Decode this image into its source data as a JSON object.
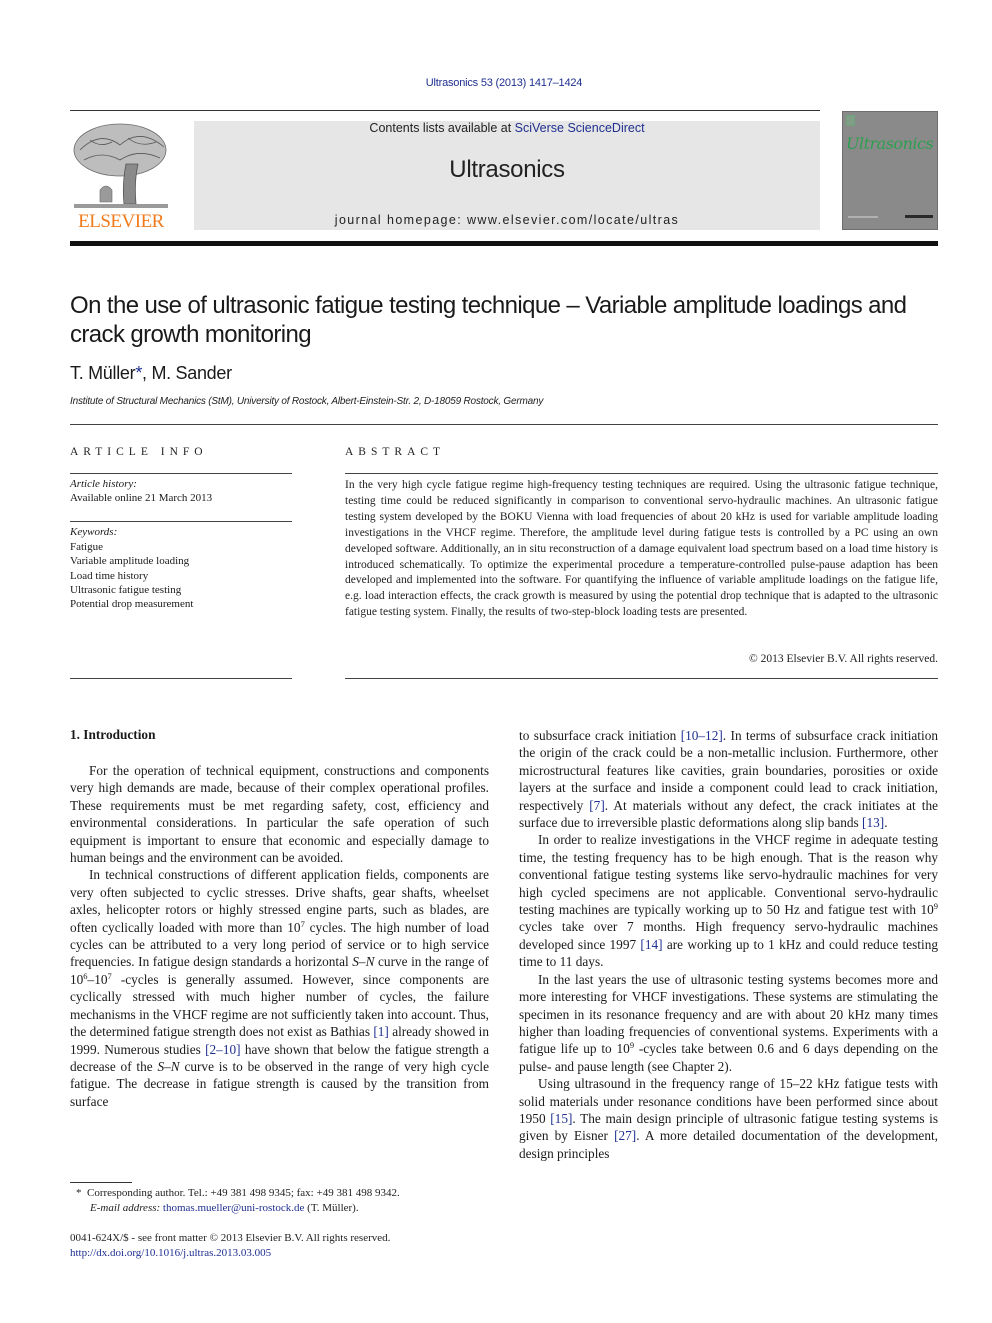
{
  "header": {
    "citation": "Ultrasonics 53 (2013) 1417–1424",
    "contents_prefix": "Contents lists available at ",
    "contents_link": "SciVerse ScienceDirect",
    "journal_name": "Ultrasonics",
    "homepage": "journal homepage: www.elsevier.com/locate/ultras",
    "publisher_logo_text": "ELSEVIER",
    "cover_title": "Ultrasonics",
    "colors": {
      "link": "#1f2f8f",
      "elsevier_orange": "#f07b1d",
      "cover_green": "#2e9e4f",
      "banner_bg": "#e6e6e6"
    }
  },
  "article": {
    "title": "On the use of ultrasonic fatigue testing technique – Variable amplitude loadings and crack growth monitoring",
    "authors": [
      {
        "name": "T. Müller",
        "marker": "*"
      },
      {
        "name": "M. Sander",
        "marker": ""
      }
    ],
    "author_separator": ", ",
    "affiliation": "Institute of Structural Mechanics (StM), University of Rostock, Albert-Einstein-Str. 2, D-18059 Rostock, Germany"
  },
  "article_info": {
    "heading": "ARTICLE INFO",
    "history_label": "Article history:",
    "history_value": "Available online 21 March 2013",
    "keywords_label": "Keywords:",
    "keywords": [
      "Fatigue",
      "Variable amplitude loading",
      "Load time history",
      "Ultrasonic fatigue testing",
      "Potential drop measurement"
    ]
  },
  "abstract": {
    "heading": "ABSTRACT",
    "text": "In the very high cycle fatigue regime high-frequency testing techniques are required. Using the ultrasonic fatigue technique, testing time could be reduced significantly in comparison to conventional servo-hydraulic machines. An ultrasonic fatigue testing system developed by the BOKU Vienna with load frequencies of about 20 kHz is used for variable amplitude loading investigations in the VHCF regime. Therefore, the amplitude level during fatigue tests is controlled by a PC using an own developed software. Additionally, an in situ reconstruction of a damage equivalent load spectrum based on a load time history is introduced schematically. To optimize the experimental procedure a temperature-controlled pulse-pause adaption has been developed and implemented into the software. For quantifying the influence of variable amplitude loadings on the fatigue life, e.g. load interaction effects, the crack growth is measured by using the potential drop technique that is adapted to the ultrasonic fatigue testing system. Finally, the results of two-step-block loading tests are presented.",
    "copyright": "© 2013 Elsevier B.V. All rights reserved."
  },
  "body": {
    "section_heading": "1. Introduction",
    "p1": "For the operation of technical equipment, constructions and components very high demands are made, because of their complex operational profiles. These requirements must be met regarding safety, cost, efficiency and environmental considerations. In particular the safe operation of such equipment is important to ensure that economic and especially damage to human beings and the environment can be avoided.",
    "p2": {
      "a": "In technical constructions of different application fields, components are very often subjected to cyclic stresses. Drive shafts, gear shafts, wheelset axles, helicopter rotors or highly stressed engine parts, such as blades, are often cyclically loaded with more than 10",
      "a_sup": "7",
      "b": " cycles. The high number of load cycles can be attributed to a very long period of service or to high service frequencies. In fatigue design standards a horizontal ",
      "sn1": "S–N",
      "c": " curve in the range of 10",
      "c_sup1": "6",
      "d": "–10",
      "d_sup": "7",
      "e": " -cycles is generally assumed. However, since components are cyclically stressed with much higher number of cycles, the failure mechanisms in the VHCF regime are not sufficiently taken into account. Thus, the determined fatigue strength does not exist as Bathias ",
      "ref1": "[1]",
      "f": " already showed in 1999. Numerous studies ",
      "ref2": "[2–10]",
      "g": " have shown that below the fatigue strength a decrease of the ",
      "sn2": "S–N",
      "h": " curve is to be observed in the range of very high cycle fatigue. The decrease in fatigue strength is caused by the transition from surface "
    },
    "p2_cont": {
      "a": "to subsurface crack initiation ",
      "ref1": "[10–12]",
      "b": ". In terms of subsurface crack initiation the origin of the crack could be a non-metallic inclusion. Furthermore, other microstructural features like cavities, grain boundaries, porosities or oxide layers at the surface and inside a component could lead to crack initiation, respectively ",
      "ref2": "[7]",
      "c": ". At materials without any defect, the crack initiates at the surface due to irreversible plastic deformations along slip bands ",
      "ref3": "[13]",
      "d": "."
    },
    "p3": {
      "a": "In order to realize investigations in the VHCF regime in adequate testing time, the testing frequency has to be high enough. That is the reason why conventional fatigue testing systems like servo-hydraulic machines for very high cycled specimens are not applicable. Conventional servo-hydraulic testing machines are typically working up to 50 Hz and fatigue test with 10",
      "sup": "9",
      "b": " cycles take over 7 months. High frequency servo-hydraulic machines developed since 1997 ",
      "ref": "[14]",
      "c": " are working up to 1 kHz and could reduce testing time to 11 days."
    },
    "p4": {
      "a": "In the last years the use of ultrasonic testing systems becomes more and more interesting for VHCF investigations. These systems are stimulating the specimen in its resonance frequency and are with about 20 kHz many times higher than loading frequencies of conventional systems. Experiments with a fatigue life up to 10",
      "sup": "9",
      "b": " -cycles take between 0.6 and 6 days depending on the pulse- and pause length (see Chapter 2)."
    },
    "p5": {
      "a": "Using ultrasound in the frequency range of 15–22 kHz fatigue tests with solid materials under resonance conditions have been performed since about 1950 ",
      "ref1": "[15]",
      "b": ". The main design principle of ultrasonic fatigue testing systems is given by Eisner ",
      "ref2": "[27]",
      "c": ". A more detailed documentation of the development, design principles"
    }
  },
  "footnotes": {
    "marker": "*",
    "corresponding": "Corresponding author. Tel.: +49 381 498 9345; fax: +49 381 498 9342.",
    "email_label": "E-mail address:",
    "email": "thomas.mueller@uni-rostock.de",
    "email_suffix": " (T. Müller).",
    "issn_line": "0041-624X/$ - see front matter © 2013 Elsevier B.V. All rights reserved.",
    "doi": "http://dx.doi.org/10.1016/j.ultras.2013.03.005"
  }
}
